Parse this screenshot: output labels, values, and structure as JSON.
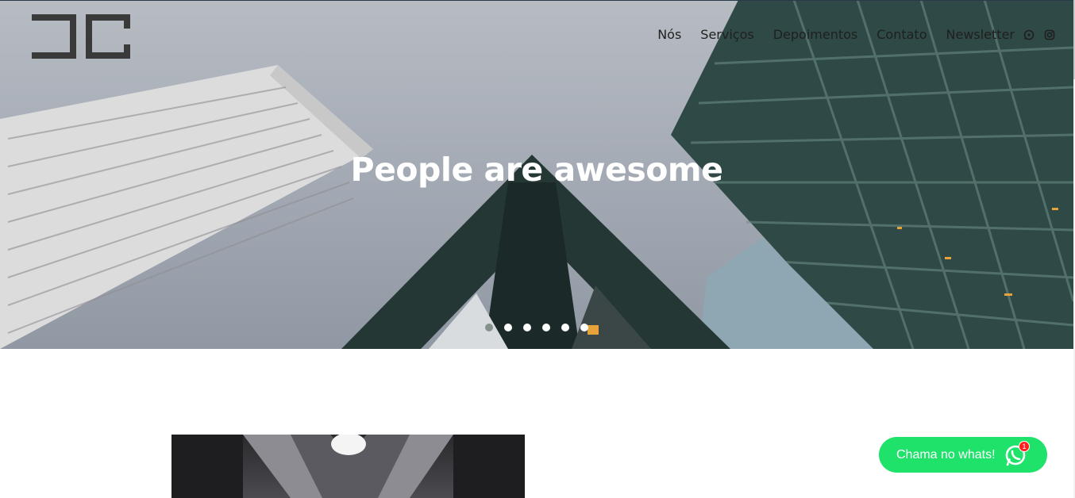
{
  "nav": {
    "items": [
      {
        "label": "Nós"
      },
      {
        "label": "Serviços"
      },
      {
        "label": "Depoimentos"
      },
      {
        "label": "Contato"
      },
      {
        "label": "Newsletter"
      }
    ],
    "icons": [
      "whatsapp-icon",
      "instagram-icon"
    ]
  },
  "hero": {
    "title": "People are awesome",
    "slides_total": 6,
    "active_slide": 1
  },
  "whatsapp": {
    "label": "Chama no whats!",
    "badge": "1",
    "color": "#1fe26b"
  },
  "colors": {
    "nav_text": "#1f1f1f",
    "hero_title": "#ffffff",
    "badge": "#ff1e1e"
  }
}
